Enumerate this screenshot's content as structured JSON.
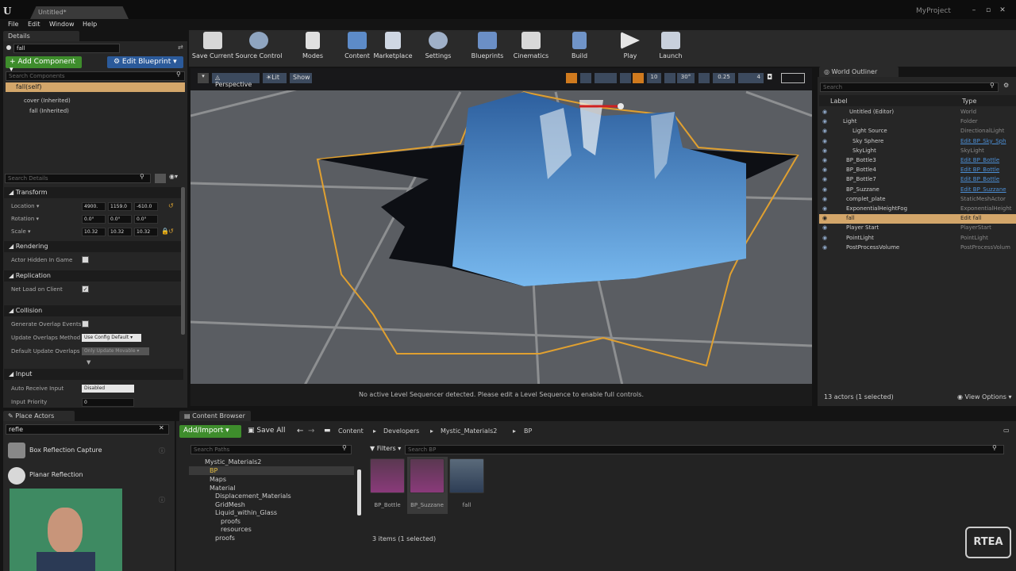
{
  "window": {
    "tab": "Untitled*",
    "project": "MyProject"
  },
  "menu": [
    "File",
    "Edit",
    "Window",
    "Help"
  ],
  "details": {
    "tab": "Details",
    "name_value": "fall",
    "add_component": "+ Add Component ▾",
    "edit_blueprint": "⚙ Edit Blueprint ▾",
    "search_components_placeholder": "Search Components",
    "self_label": "fall(self)",
    "tree": [
      "cover (Inherited)",
      "fall (Inherited)"
    ],
    "search_details_placeholder": "Search Details"
  },
  "transform": {
    "section": "Transform",
    "location_label": "Location ▾",
    "rotation_label": "Rotation ▾",
    "scale_label": "Scale ▾",
    "location": [
      "4900.",
      "1159.0",
      "-610.0"
    ],
    "rotation": [
      "0.0°",
      "0.0°",
      "0.0°"
    ],
    "scale": [
      "10.32",
      "10.32",
      "10.32"
    ]
  },
  "rendering": {
    "section": "Rendering",
    "actor_hidden": "Actor Hidden In Game"
  },
  "replication": {
    "section": "Replication",
    "net_load": "Net Load on Client",
    "check": "✓"
  },
  "collision": {
    "section": "Collision",
    "gen_overlap": "Generate Overlap Events",
    "update_method": "Update Overlaps Method",
    "update_value": "Use Config Default ▾",
    "default_update": "Default Update Overlaps I",
    "default_value": "Only Update Movable ▾"
  },
  "input": {
    "section": "Input",
    "auto_receive": "Auto Receive Input",
    "auto_value": "Disabled",
    "input_priority": "Input Priority",
    "priority_value": "0"
  },
  "toolbar": [
    "Save Current",
    "Source Control",
    "Modes",
    "Content",
    "Marketplace",
    "Settings",
    "Blueprints",
    "Cinematics",
    "Build",
    "Play",
    "Launch"
  ],
  "viewport": {
    "perspective": "Perspective",
    "lit": "Lit",
    "show": "Show",
    "grid": "10",
    "angle": "30°",
    "scale": "0.25",
    "cam": "4",
    "message": "No active Level Sequencer detected. Please edit a Level Sequence to enable full controls."
  },
  "outliner": {
    "tab": "World Outliner",
    "search_placeholder": "Search",
    "col_label": "Label",
    "col_type": "Type",
    "footer": "13 actors (1 selected)",
    "view_options": "View Options ▾",
    "rows": [
      {
        "label": "Untitled (Editor)",
        "type": "World",
        "link": false
      },
      {
        "label": "Light",
        "type": "Folder",
        "link": false
      },
      {
        "label": "Light Source",
        "type": "DirectionalLight",
        "link": false
      },
      {
        "label": "Sky Sphere",
        "type": "Edit BP_Sky_Sph",
        "link": true
      },
      {
        "label": "SkyLight",
        "type": "SkyLight",
        "link": false
      },
      {
        "label": "BP_Bottle3",
        "type": "Edit BP_Bottle",
        "link": true
      },
      {
        "label": "BP_Bottle4",
        "type": "Edit BP_Bottle",
        "link": true
      },
      {
        "label": "BP_Bottle7",
        "type": "Edit BP_Bottle",
        "link": true
      },
      {
        "label": "BP_Suzzane",
        "type": "Edit BP_Suzzane",
        "link": true
      },
      {
        "label": "complet_plate",
        "type": "StaticMeshActor",
        "link": false
      },
      {
        "label": "ExponentialHeightFog",
        "type": "ExponentialHeight",
        "link": false
      },
      {
        "label": "fall",
        "type": "Edit fall",
        "link": false
      },
      {
        "label": "Player Start",
        "type": "PlayerStart",
        "link": false
      },
      {
        "label": "PointLight",
        "type": "PointLight",
        "link": false
      },
      {
        "label": "PostProcessVolume",
        "type": "PostProcessVolum",
        "link": false
      }
    ]
  },
  "place": {
    "tab": "Place Actors",
    "search": "refle",
    "items": [
      "Box Reflection Capture",
      "Planar Reflection"
    ],
    "highlight": "Refle",
    "hl2": "Refle"
  },
  "content": {
    "tab": "Content Browser",
    "add_import": "Add/Import ▾",
    "save_all": "Save All",
    "crumbs": [
      "Content",
      "Developers",
      "Mystic_Materials2",
      "BP"
    ],
    "search_paths": "Search Paths",
    "filters": "Filters ▾",
    "search_bp": "Search BP",
    "footer": "3 items (1 selected)",
    "tree": [
      "Mystic_Materials2",
      "BP",
      "Maps",
      "Material",
      "Displacement_Materials",
      "GridMesh",
      "Liquid_within_Glass",
      "proofs",
      "resources",
      "proofs"
    ],
    "assets": [
      "BP_Bottle",
      "BP_Suzzane",
      "fall"
    ]
  },
  "watermark": "RTEA"
}
